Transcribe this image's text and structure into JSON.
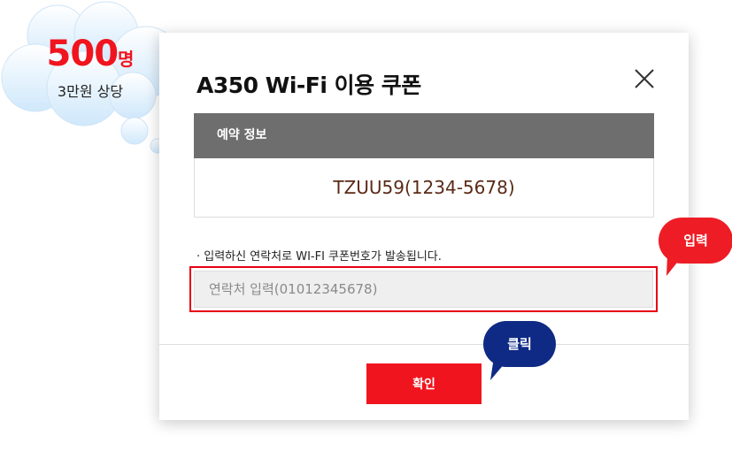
{
  "promo": {
    "count": "500",
    "unit": "명",
    "subtitle": "3만원 상당"
  },
  "modal": {
    "title": "A350 Wi-Fi 이용 쿠폰",
    "close_icon": "close-icon",
    "reservation": {
      "header": "예약 정보",
      "value": "TZUU59(1234-5678)"
    },
    "note": "· 입력하신 연락처로 WI-FI 쿠폰번호가 발송됩니다.",
    "phone_input": {
      "value": "",
      "placeholder": "연락처 입력(01012345678)"
    },
    "confirm_label": "확인"
  },
  "callouts": {
    "input_label": "입력",
    "click_label": "클릭"
  },
  "colors": {
    "accent_red": "#f0141e",
    "header_gray": "#6e6e6f",
    "callout_navy": "#0f2a84",
    "reservation_text": "#5a2a16"
  }
}
